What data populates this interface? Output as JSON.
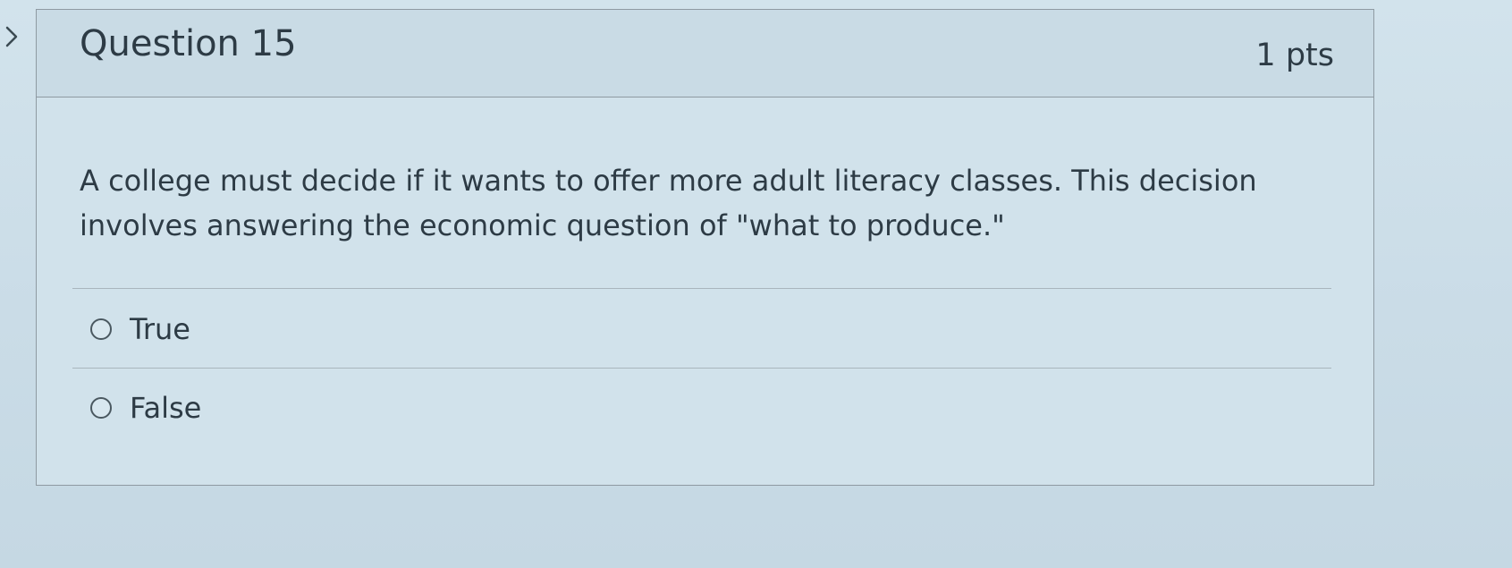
{
  "question": {
    "title": "Question 15",
    "points": "1 pts",
    "text": "A college must decide if it wants to offer more adult literacy classes. This decision involves answering the economic question of \"what to produce.\"",
    "answers": [
      {
        "label": "True",
        "selected": false
      },
      {
        "label": "False",
        "selected": false
      }
    ]
  },
  "icons": {
    "side_nav": "chevron-right-icon"
  }
}
